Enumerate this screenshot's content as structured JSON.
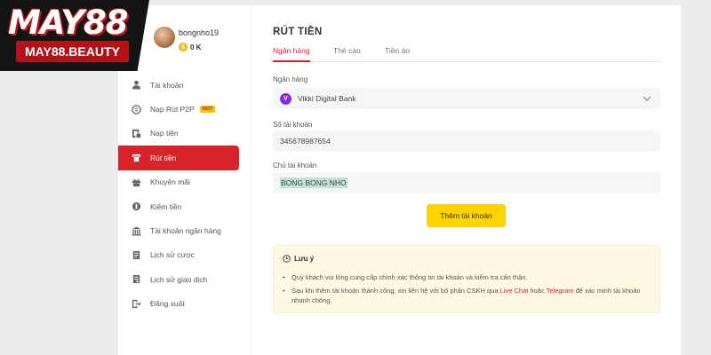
{
  "brand": {
    "name": "MAY88",
    "domain": "MAY88.BEAUTY"
  },
  "user": {
    "username": "bongnho19",
    "balance": "0 K",
    "coin_symbol": "$"
  },
  "sidebar": {
    "items": [
      {
        "label": "Tài khoản",
        "icon": "user-icon",
        "active": false
      },
      {
        "label": "Nạp Rút P2P",
        "icon": "p2p-icon",
        "active": false,
        "badge": "HOT"
      },
      {
        "label": "Nạp tiền",
        "icon": "deposit-icon",
        "active": false
      },
      {
        "label": "Rút tiền",
        "icon": "withdraw-icon",
        "active": true
      },
      {
        "label": "Khuyến mãi",
        "icon": "gift-icon",
        "active": false
      },
      {
        "label": "Kiếm tiền",
        "icon": "earn-icon",
        "active": false
      },
      {
        "label": "Tài khoản ngân hàng",
        "icon": "bank-icon",
        "active": false
      },
      {
        "label": "Lịch sử cược",
        "icon": "bet-history-icon",
        "active": false
      },
      {
        "label": "Lịch sử giao dịch",
        "icon": "transaction-history-icon",
        "active": false
      },
      {
        "label": "Đăng xuất",
        "icon": "logout-icon",
        "active": false
      }
    ]
  },
  "main": {
    "title": "RÚT TIỀN",
    "tabs": [
      {
        "label": "Ngân hàng",
        "active": true
      },
      {
        "label": "Thẻ cào",
        "active": false
      },
      {
        "label": "Tiền ảo",
        "active": false
      }
    ],
    "bank_label": "Ngân hàng",
    "bank_value": "Vikki Digital Bank",
    "bank_logo_letter": "V",
    "account_number_label": "Số tài khoản",
    "account_number_value": "345678987654",
    "account_holder_label": "Chủ tài khoản",
    "account_holder_value": "BONG BONG NHO",
    "add_button": "Thêm tài khoản"
  },
  "note": {
    "title": "Lưu ý",
    "item1": "Quý khách vui lòng cung cấp chính xác thông tin tài khoản và kiểm tra cẩn thận.",
    "item2_prefix": "Sau khi thêm tài khoản thành công, xin liên hệ với bộ phận CSKH qua ",
    "item2_live": "Live Chat",
    "item2_mid": " hoặc ",
    "item2_tele": "Telegram",
    "item2_suffix": " để xác minh tài khoản nhanh chóng."
  },
  "colors": {
    "accent": "#d8232a",
    "button": "#fdd300",
    "note_bg": "#fff9e3",
    "page_bg": "#ededed"
  }
}
